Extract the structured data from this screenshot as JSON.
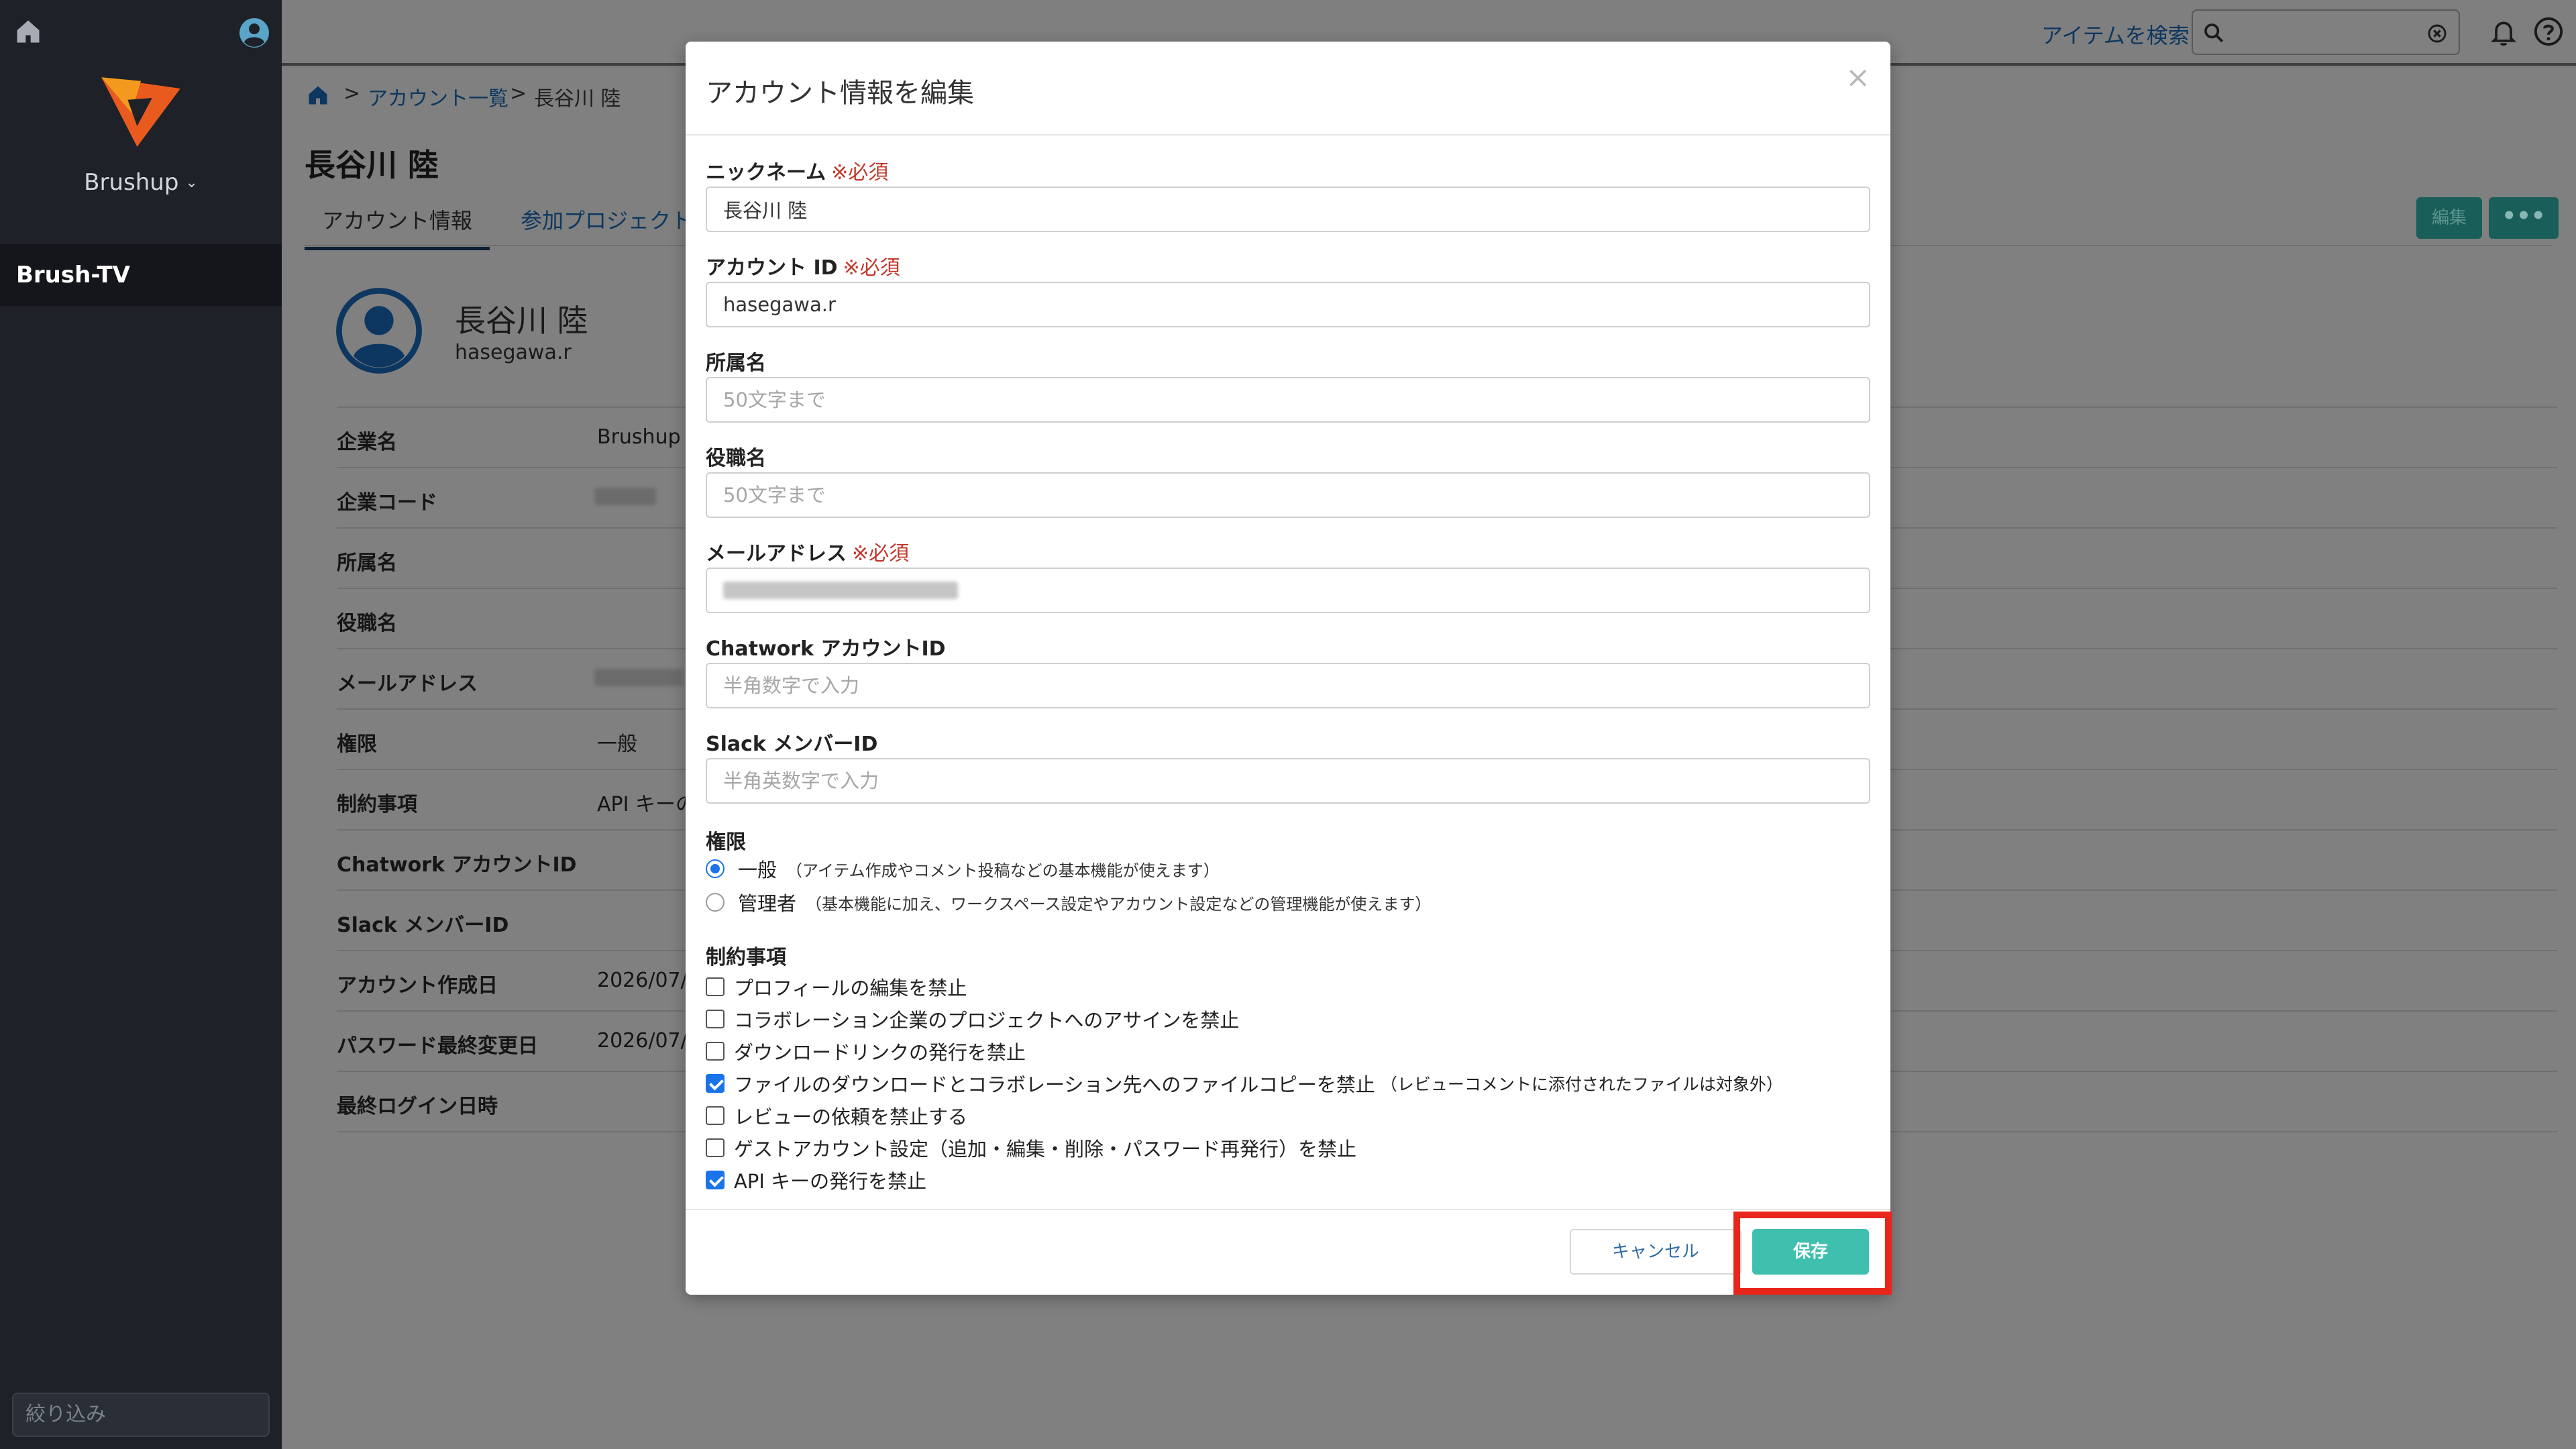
{
  "sidebar": {
    "workspace_name": "Brushup",
    "workspace_chevron": "⌄",
    "nav_item": "Brush-TV",
    "filter_placeholder": "絞り込み"
  },
  "topbar": {
    "search_link": "アイテムを検索",
    "icons": [
      "home-icon",
      "user-avatar-icon",
      "search-icon",
      "clear-icon",
      "bell-icon",
      "help-icon"
    ]
  },
  "page": {
    "breadcrumb": {
      "separator": ">",
      "account_list": "アカウント一覧",
      "current": "長谷川 陸"
    },
    "title": "長谷川 陸",
    "tabs": [
      "アカウント情報",
      "参加プロジェクト"
    ],
    "edit_button": "編集",
    "more_button": "•••",
    "profile": {
      "name": "長谷川 陸",
      "account_id": "hasegawa.r"
    },
    "rows": [
      {
        "label": "企業名",
        "value": "Brushup"
      },
      {
        "label": "企業コード",
        "value": ""
      },
      {
        "label": "所属名",
        "value": ""
      },
      {
        "label": "役職名",
        "value": ""
      },
      {
        "label": "メールアドレス",
        "value": ""
      },
      {
        "label": "権限",
        "value": "一般"
      },
      {
        "label": "制約事項",
        "value": "API キーの"
      },
      {
        "label": "Chatwork アカウントID",
        "value": ""
      },
      {
        "label": "Slack メンバーID",
        "value": ""
      },
      {
        "label": "アカウント作成日",
        "value": "2026/07/"
      },
      {
        "label": "パスワード最終変更日",
        "value": "2026/07/"
      },
      {
        "label": "最終ログイン日時",
        "value": ""
      }
    ]
  },
  "modal": {
    "title": "アカウント情報を編集",
    "close": "×",
    "required_mark": "※必須",
    "fields": {
      "nickname": {
        "label": "ニックネーム",
        "value": "長谷川 陸",
        "placeholder": ""
      },
      "account_id": {
        "label": "アカウント ID",
        "value": "hasegawa.r",
        "placeholder": ""
      },
      "department": {
        "label": "所属名",
        "value": "",
        "placeholder": "50文字まで"
      },
      "position": {
        "label": "役職名",
        "value": "",
        "placeholder": "50文字まで"
      },
      "email": {
        "label": "メールアドレス",
        "value": "",
        "placeholder": ""
      },
      "chatwork": {
        "label": "Chatwork アカウントID",
        "value": "",
        "placeholder": "半角数字で入力"
      },
      "slack": {
        "label": "Slack メンバーID",
        "value": "",
        "placeholder": "半角英数字で入力"
      }
    },
    "role": {
      "label": "権限",
      "options": [
        {
          "name": "一般",
          "desc": "（アイテム作成やコメント投稿などの基本機能が使えます）",
          "selected": true
        },
        {
          "name": "管理者",
          "desc": "（基本機能に加え、ワークスペース設定やアカウント設定などの管理機能が使えます）",
          "selected": false
        }
      ]
    },
    "restrictions": {
      "label": "制約事項",
      "items": [
        {
          "text": "プロフィールの編集を禁止",
          "desc": "",
          "checked": false
        },
        {
          "text": "コラボレーション企業のプロジェクトへのアサインを禁止",
          "desc": "",
          "checked": false
        },
        {
          "text": "ダウンロードリンクの発行を禁止",
          "desc": "",
          "checked": false
        },
        {
          "text": "ファイルのダウンロードとコラボレーション先へのファイルコピーを禁止",
          "desc": "（レビューコメントに添付されたファイルは対象外）",
          "checked": true
        },
        {
          "text": "レビューの依頼を禁止する",
          "desc": "",
          "checked": false
        },
        {
          "text": "ゲストアカウント設定（追加・編集・削除・パスワード再発行）を禁止",
          "desc": "",
          "checked": false
        },
        {
          "text": "API キーの発行を禁止",
          "desc": "",
          "checked": true
        }
      ]
    },
    "cancel_button": "キャンセル",
    "save_button": "保存"
  },
  "colors": {
    "accent": "#3fbfae",
    "link": "#2e6da4",
    "required": "#c0392b",
    "highlight": "#e8261c",
    "sidebar": "#1e2128"
  }
}
